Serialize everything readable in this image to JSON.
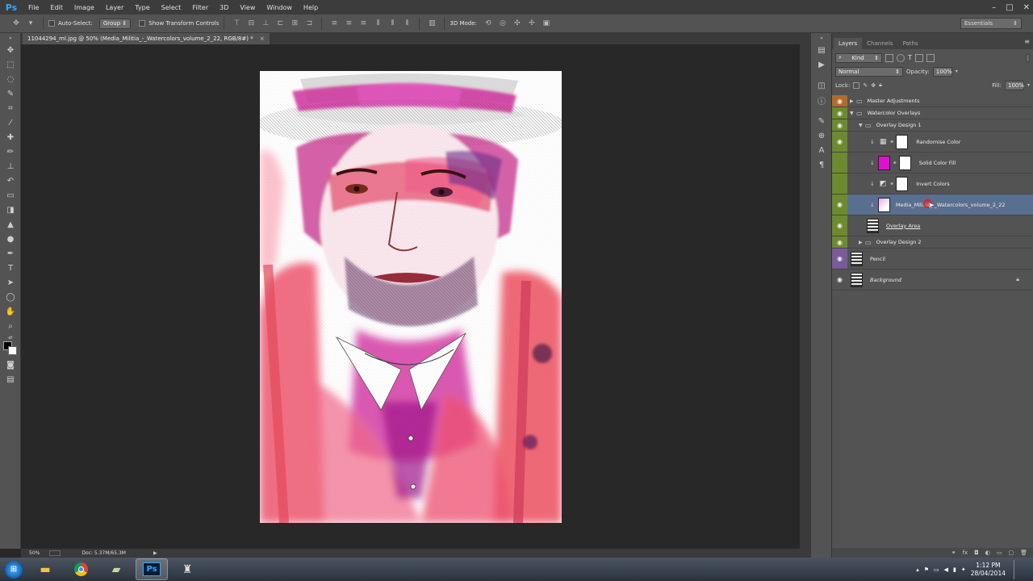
{
  "app": {
    "logo": "Ps"
  },
  "menu": [
    "File",
    "Edit",
    "Image",
    "Layer",
    "Type",
    "Select",
    "Filter",
    "3D",
    "View",
    "Window",
    "Help"
  ],
  "window_controls": {
    "minimize": "–",
    "maximize": "□",
    "close": "✕"
  },
  "options_bar": {
    "auto_select_label": "Auto-Select:",
    "auto_select_value": "Group",
    "show_transform_label": "Show Transform Controls",
    "mode_3d_label": "3D Mode:",
    "workspace": "Essentials"
  },
  "document": {
    "tab_title": "11044294_ml.jpg @ 50% (Media_Militia_-_Watercolors_volume_2_22, RGB/8#) *",
    "tab_close": "×",
    "zoom": "50%",
    "doc_size": "Doc: 5.37M/65.3M"
  },
  "layers_panel": {
    "tabs": [
      "Layers",
      "Channels",
      "Paths"
    ],
    "filter_kind": "Kind",
    "blend_mode": "Normal",
    "opacity_label": "Opacity:",
    "opacity_value": "100%",
    "lock_label": "Lock:",
    "fill_label": "Fill:",
    "fill_value": "100%",
    "layers": [
      {
        "name": "Master Adjustments",
        "type": "group",
        "eye": "red"
      },
      {
        "name": "Watercolor Overlays",
        "type": "group-open",
        "eye": "green"
      },
      {
        "name": "Overlay Design 1",
        "type": "group-open",
        "eye": "green"
      },
      {
        "name": "Randomise Color",
        "type": "adjustment",
        "eye": "green"
      },
      {
        "name": "Solid Color Fill",
        "type": "fill",
        "eye": "green-hidden"
      },
      {
        "name": "Invert Colors",
        "type": "adjustment",
        "eye": "green-hidden"
      },
      {
        "name": "Media_Militia_-_Watercolors_volume_2_22",
        "type": "smart",
        "eye": "green",
        "selected": true
      },
      {
        "name": "Overlay Area",
        "type": "image",
        "eye": "green"
      },
      {
        "name": "Overlay Design 2",
        "type": "group",
        "eye": "green"
      },
      {
        "name": "Pencil",
        "type": "image",
        "eye": "violet"
      },
      {
        "name": "Background",
        "type": "background",
        "eye": "none"
      }
    ]
  },
  "taskbar": {
    "apps": [
      "explorer-icon",
      "chrome-icon",
      "file-icon",
      "photoshop-icon",
      "game-icon"
    ],
    "time": "1:12 PM",
    "date": "28/04/2014"
  }
}
